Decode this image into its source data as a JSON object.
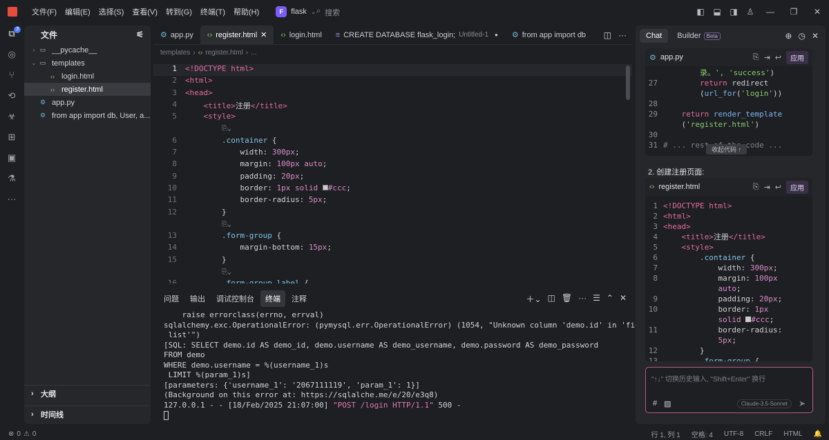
{
  "titlebar": {
    "menus": [
      "文件(F)",
      "编辑(E)",
      "选择(S)",
      "查看(V)",
      "转到(G)",
      "终端(T)",
      "帮助(H)"
    ],
    "project_initial": "F",
    "project": "flask",
    "search_placeholder": "搜索"
  },
  "activity": {
    "badge": "3"
  },
  "sidebar": {
    "title": "文件",
    "items": [
      {
        "label": "__pycache__",
        "type": "folder",
        "expanded": false,
        "indent": 0
      },
      {
        "label": "templates",
        "type": "folder",
        "expanded": true,
        "indent": 0
      },
      {
        "label": "login.html",
        "type": "html",
        "indent": 1
      },
      {
        "label": "register.html",
        "type": "html",
        "indent": 1,
        "selected": true
      },
      {
        "label": "app.py",
        "type": "py",
        "indent": 0
      },
      {
        "label": "from app import db, User, a...",
        "type": "py",
        "indent": 0
      }
    ],
    "outline": "大纲",
    "timeline": "时间线"
  },
  "editor": {
    "tabs": [
      {
        "label": "app.py",
        "icon": "py"
      },
      {
        "label": "register.html",
        "icon": "html",
        "active": true
      },
      {
        "label": "login.html",
        "icon": "html"
      },
      {
        "label": "CREATE DATABASE flask_login;",
        "sub": "Untitled-1",
        "icon": "db",
        "modified": true
      },
      {
        "label": "from app import db",
        "icon": "py"
      }
    ],
    "breadcrumb": [
      "templates",
      "register.html",
      "..."
    ]
  },
  "code_lines": [
    {
      "n": "1",
      "cur": true,
      "html": "<span class='t'>&lt;!DOCTYPE</span> <span class='k'>html</span><span class='t'>&gt;</span>"
    },
    {
      "n": "2",
      "html": "<span class='t'>&lt;html&gt;</span>"
    },
    {
      "n": "3",
      "html": "<span class='t'>&lt;head&gt;</span>"
    },
    {
      "n": "4",
      "html": "    <span class='t'>&lt;title&gt;</span>注册<span class='t'>&lt;/title&gt;</span>"
    },
    {
      "n": "5",
      "html": "    <span class='t'>&lt;style&gt;</span>"
    },
    {
      "n": "",
      "html": "        <span class='fold'>⎘⌄</span>"
    },
    {
      "n": "6",
      "html": "        <span class='sel1'>.container</span> {"
    },
    {
      "n": "7",
      "html": "            width: <span class='n'>300px</span>;"
    },
    {
      "n": "8",
      "html": "            margin: <span class='n'>100px</span> <span class='n'>auto</span>;"
    },
    {
      "n": "9",
      "html": "            padding: <span class='n'>20px</span>;"
    },
    {
      "n": "10",
      "html": "            border: <span class='n'>1px</span> <span class='n'>solid</span> <span style='display:inline-block;width:8px;height:8px;background:#ccc;border:1px solid #888'></span><span class='n'>#ccc</span>;"
    },
    {
      "n": "11",
      "html": "            border-radius: <span class='n'>5px</span>;"
    },
    {
      "n": "12",
      "html": "        }"
    },
    {
      "n": "",
      "html": "        <span class='fold'>⎘⌄</span>"
    },
    {
      "n": "13",
      "html": "        <span class='sel1'>.form-group</span> {"
    },
    {
      "n": "14",
      "html": "            margin-bottom: <span class='n'>15px</span>;"
    },
    {
      "n": "15",
      "html": "        }"
    },
    {
      "n": "",
      "html": "        <span class='fold'>⎘⌄</span>"
    },
    {
      "n": "16",
      "html": "        <span class='sel1'>.form-group label</span> {"
    }
  ],
  "panel": {
    "tabs": [
      "问题",
      "输出",
      "调试控制台",
      "终端",
      "注释"
    ],
    "active": "终端"
  },
  "terminal": [
    "    raise errorclass(errno, errval)",
    "sqlalchemy.exc.OperationalError: (pymysql.err.OperationalError) (1054, \"Unknown column 'demo.id' in 'field",
    " list'\")",
    "[SQL: SELECT demo.id AS demo_id, demo.username AS demo_username, demo.password AS demo_password",
    "FROM demo",
    "WHERE demo.username = %(username_1)s",
    " LIMIT %(param_1)s]",
    "[parameters: {'username_1': '2067111119', 'param_1': 1}]",
    "(Background on this error at: https://sqlalche.me/e/20/e3q8)"
  ],
  "terminal_last": {
    "prefix": "127.0.0.1 - - [18/Feb/2025 21:07:00] ",
    "request": "\"POST /login HTTP/1.1\"",
    "suffix": " 500 -"
  },
  "chat": {
    "tabs": [
      "Chat",
      "Builder"
    ],
    "beta": "Beta",
    "block1": {
      "file": "app.py",
      "apply": "应用",
      "collapse": "收起代码 ↑"
    },
    "block1_lines": [
      {
        "n": "",
        "html": "        <span class='s'>录。', 'success'</span>)"
      },
      {
        "n": "27",
        "html": "        <span class='k'>return</span> redirect"
      },
      {
        "n": "",
        "html": "        (<span class='f'>url_for</span>(<span class='s'>'login'</span>))"
      },
      {
        "n": "28",
        "html": ""
      },
      {
        "n": "29",
        "html": "    <span class='k'>return</span> <span class='f'>render_template</span>"
      },
      {
        "n": "",
        "html": "    (<span class='s'>'register.html'</span>)"
      },
      {
        "n": "30",
        "html": ""
      },
      {
        "n": "31",
        "html": "<span class='c'># ... rest of the code ...</span>"
      }
    ],
    "step": "2. 创建注册页面:",
    "block2": {
      "file": "register.html",
      "apply": "应用"
    },
    "block2_lines": [
      {
        "n": "1",
        "html": "<span class='t'>&lt;!DOCTYPE</span> <span class='k'>html</span><span class='t'>&gt;</span>"
      },
      {
        "n": "2",
        "html": "<span class='t'>&lt;html&gt;</span>"
      },
      {
        "n": "3",
        "html": "<span class='t'>&lt;head&gt;</span>"
      },
      {
        "n": "4",
        "html": "    <span class='t'>&lt;title&gt;</span>注册<span class='t'>&lt;/title&gt;</span>"
      },
      {
        "n": "5",
        "html": "    <span class='t'>&lt;style&gt;</span>"
      },
      {
        "n": "6",
        "html": "        <span class='sel1'>.container</span> {"
      },
      {
        "n": "7",
        "html": "            width: <span class='n'>300px</span>;"
      },
      {
        "n": "8",
        "html": "            margin: <span class='n'>100px</span>"
      },
      {
        "n": "",
        "html": "            <span class='n'>auto</span>;"
      },
      {
        "n": "9",
        "html": "            padding: <span class='n'>20px</span>;"
      },
      {
        "n": "10",
        "html": "            border: <span class='n'>1px</span>"
      },
      {
        "n": "",
        "html": "            <span class='n'>solid</span> <span style='display:inline-block;width:8px;height:8px;background:#ccc'></span><span class='n'>#ccc</span>;"
      },
      {
        "n": "11",
        "html": "            border-radius:"
      },
      {
        "n": "",
        "html": "            <span class='n'>5px</span>;"
      },
      {
        "n": "12",
        "html": "        }"
      },
      {
        "n": "13",
        "html": "        <span class='sel1'>.form-group</span> {"
      }
    ],
    "input_placeholder": "\"↑↓\" 切换历史输入, \"Shift+Enter\" 换行",
    "model": "Claude-3.5-Sonnet"
  },
  "status": {
    "errors": "0",
    "warnings": "0",
    "position": "行 1, 列 1",
    "spaces": "空格: 4",
    "encoding": "UTF-8",
    "eol": "CRLF",
    "lang": "HTML"
  }
}
